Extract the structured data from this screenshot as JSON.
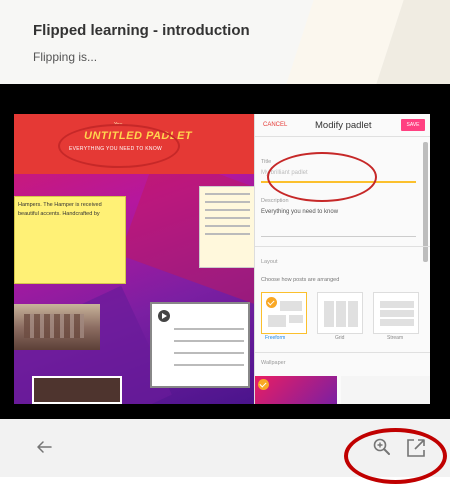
{
  "header": {
    "title": "Flipped learning - introduction",
    "subtitle": "Flipping is..."
  },
  "preview": {
    "board": {
      "user_label": "You",
      "title": "UNTITLED PADLET",
      "subtitle": "EVERYTHING YOU NEED TO KNOW",
      "note_text": "Hampers. The Hamper is received beautiful accents. Handcrafted by"
    },
    "modify_panel": {
      "cancel_label": "CANCEL",
      "title": "Modify padlet",
      "save_label": "SAVE",
      "title_field_label": "Title",
      "title_field_placeholder": "My brilliant padlet",
      "description_label": "Description",
      "description_value": "Everything you need to know",
      "layout_label": "Layout",
      "layout_hint": "Choose how posts are arranged",
      "layout_options": [
        "Freeform",
        "Grid",
        "Stream"
      ],
      "wallpaper_label": "Wallpaper"
    }
  },
  "toolbar": {
    "back_icon": "arrow-left-icon",
    "zoom_icon": "zoom-in-icon",
    "open_external_icon": "open-in-new-icon"
  },
  "colors": {
    "annotation_red": "#c00000",
    "padlet_pink": "#ff4081",
    "padlet_red": "#e53935",
    "icon_gray": "#757575"
  }
}
